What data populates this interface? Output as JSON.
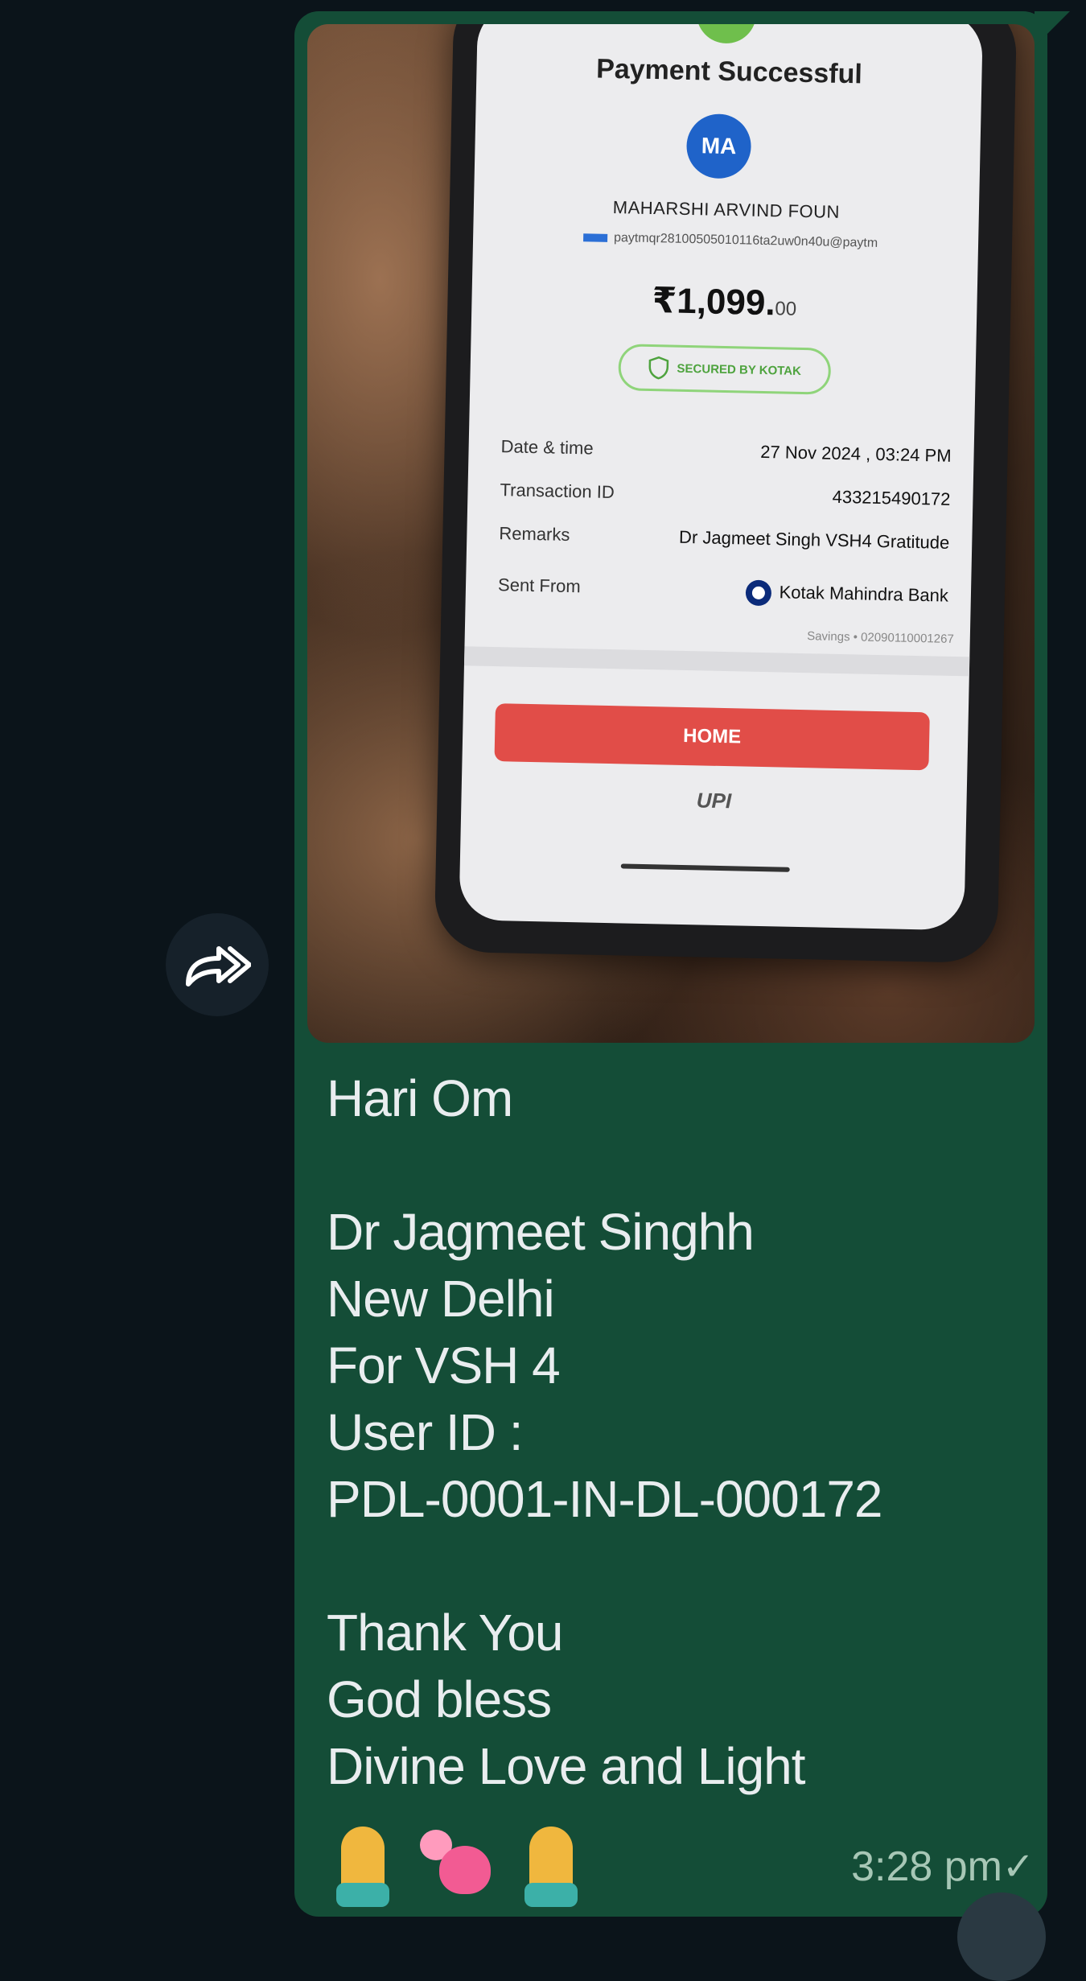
{
  "message": {
    "photo": {
      "title": "Payment Successful",
      "avatar_initials": "MA",
      "payee_name": "MAHARSHI ARVIND FOUN",
      "payee_vpa": "paytmqr2810050501011​6ta2uw0n40u@paytm",
      "amount_main": "₹1,099.",
      "amount_decimal": "00",
      "secured_label": "SECURED BY KOTAK",
      "details": [
        {
          "label": "Date & time",
          "value": "27 Nov 2024 , 03:24 PM"
        },
        {
          "label": "Transaction ID",
          "value": "433215490172"
        },
        {
          "label": "Remarks",
          "value": "Dr Jagmeet Singh VSH4 Gratitude"
        },
        {
          "label": "Sent From",
          "value": "Kotak Mahindra Bank"
        }
      ],
      "savings_account": "Savings • 02090110001267",
      "home_button": "HOME",
      "upi_logo": "UPI"
    },
    "text": "Hari Om\n\nDr Jagmeet Singhh\nNew Delhi\nFor VSH 4\nUser ID :\nPDL-0001-IN-DL-000172\n\nThank You\nGod bless\nDivine Love and Light",
    "emojis": [
      "folded-hands",
      "revolving-hearts",
      "folded-hands"
    ],
    "timestamp": "3:28 pm",
    "status_icon": "single-check"
  },
  "colors": {
    "background": "#0b141a",
    "bubble": "#144d37",
    "text": "#e9edef",
    "timestamp": "#a7c7b6"
  }
}
